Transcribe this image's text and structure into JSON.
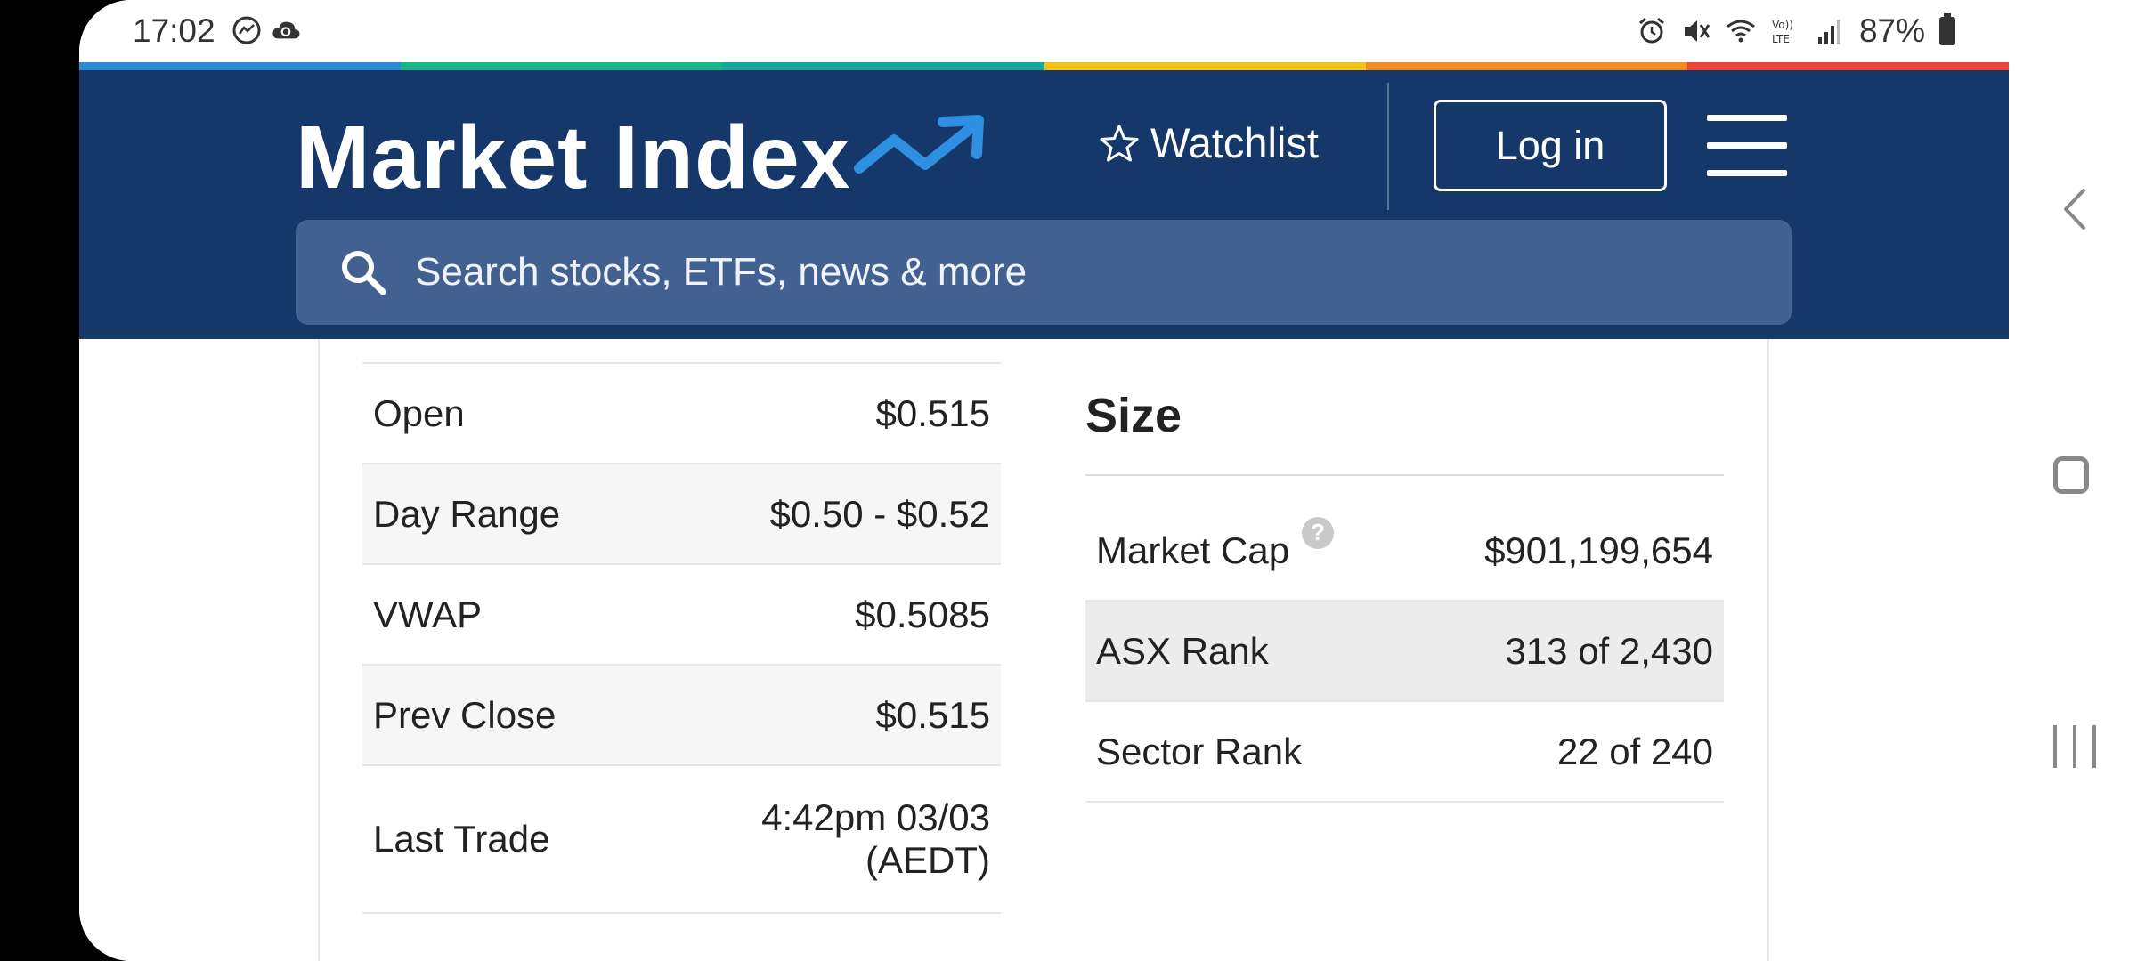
{
  "status_bar": {
    "time": "17:02",
    "battery": "87%",
    "icons_left": [
      "messenger-icon",
      "cloud-sync-icon"
    ],
    "icons_right": [
      "alarm-icon",
      "mute-icon",
      "wifi-icon",
      "volte-icon",
      "signal-icon",
      "battery-icon"
    ]
  },
  "colors": {
    "header_bg": "#163769",
    "search_bg": "#426191",
    "stripe": [
      "#2a8bd6",
      "#1bb38a",
      "#1aa79a",
      "#f2c21b",
      "#f08a22",
      "#e8443a"
    ]
  },
  "header": {
    "logo": "Market Index",
    "watchlist_label": "Watchlist",
    "login_label": "Log in",
    "search_placeholder": "Search stocks, ETFs, news & more"
  },
  "left_table": {
    "rows": [
      {
        "label": "Open",
        "value": "$0.515"
      },
      {
        "label": "Day Range",
        "value": "$0.50 - $0.52"
      },
      {
        "label": "VWAP",
        "value": "$0.5085"
      },
      {
        "label": "Prev Close",
        "value": "$0.515"
      },
      {
        "label": "Last Trade",
        "value": "4:42pm 03/03",
        "value2": "(AEDT)"
      }
    ]
  },
  "size_section": {
    "title": "Size",
    "help": "?",
    "rows": [
      {
        "label": "Market Cap",
        "value": "$901,199,654"
      },
      {
        "label": "ASX Rank",
        "value": "313 of 2,430"
      },
      {
        "label": "Sector Rank",
        "value": "22 of 240"
      }
    ]
  }
}
